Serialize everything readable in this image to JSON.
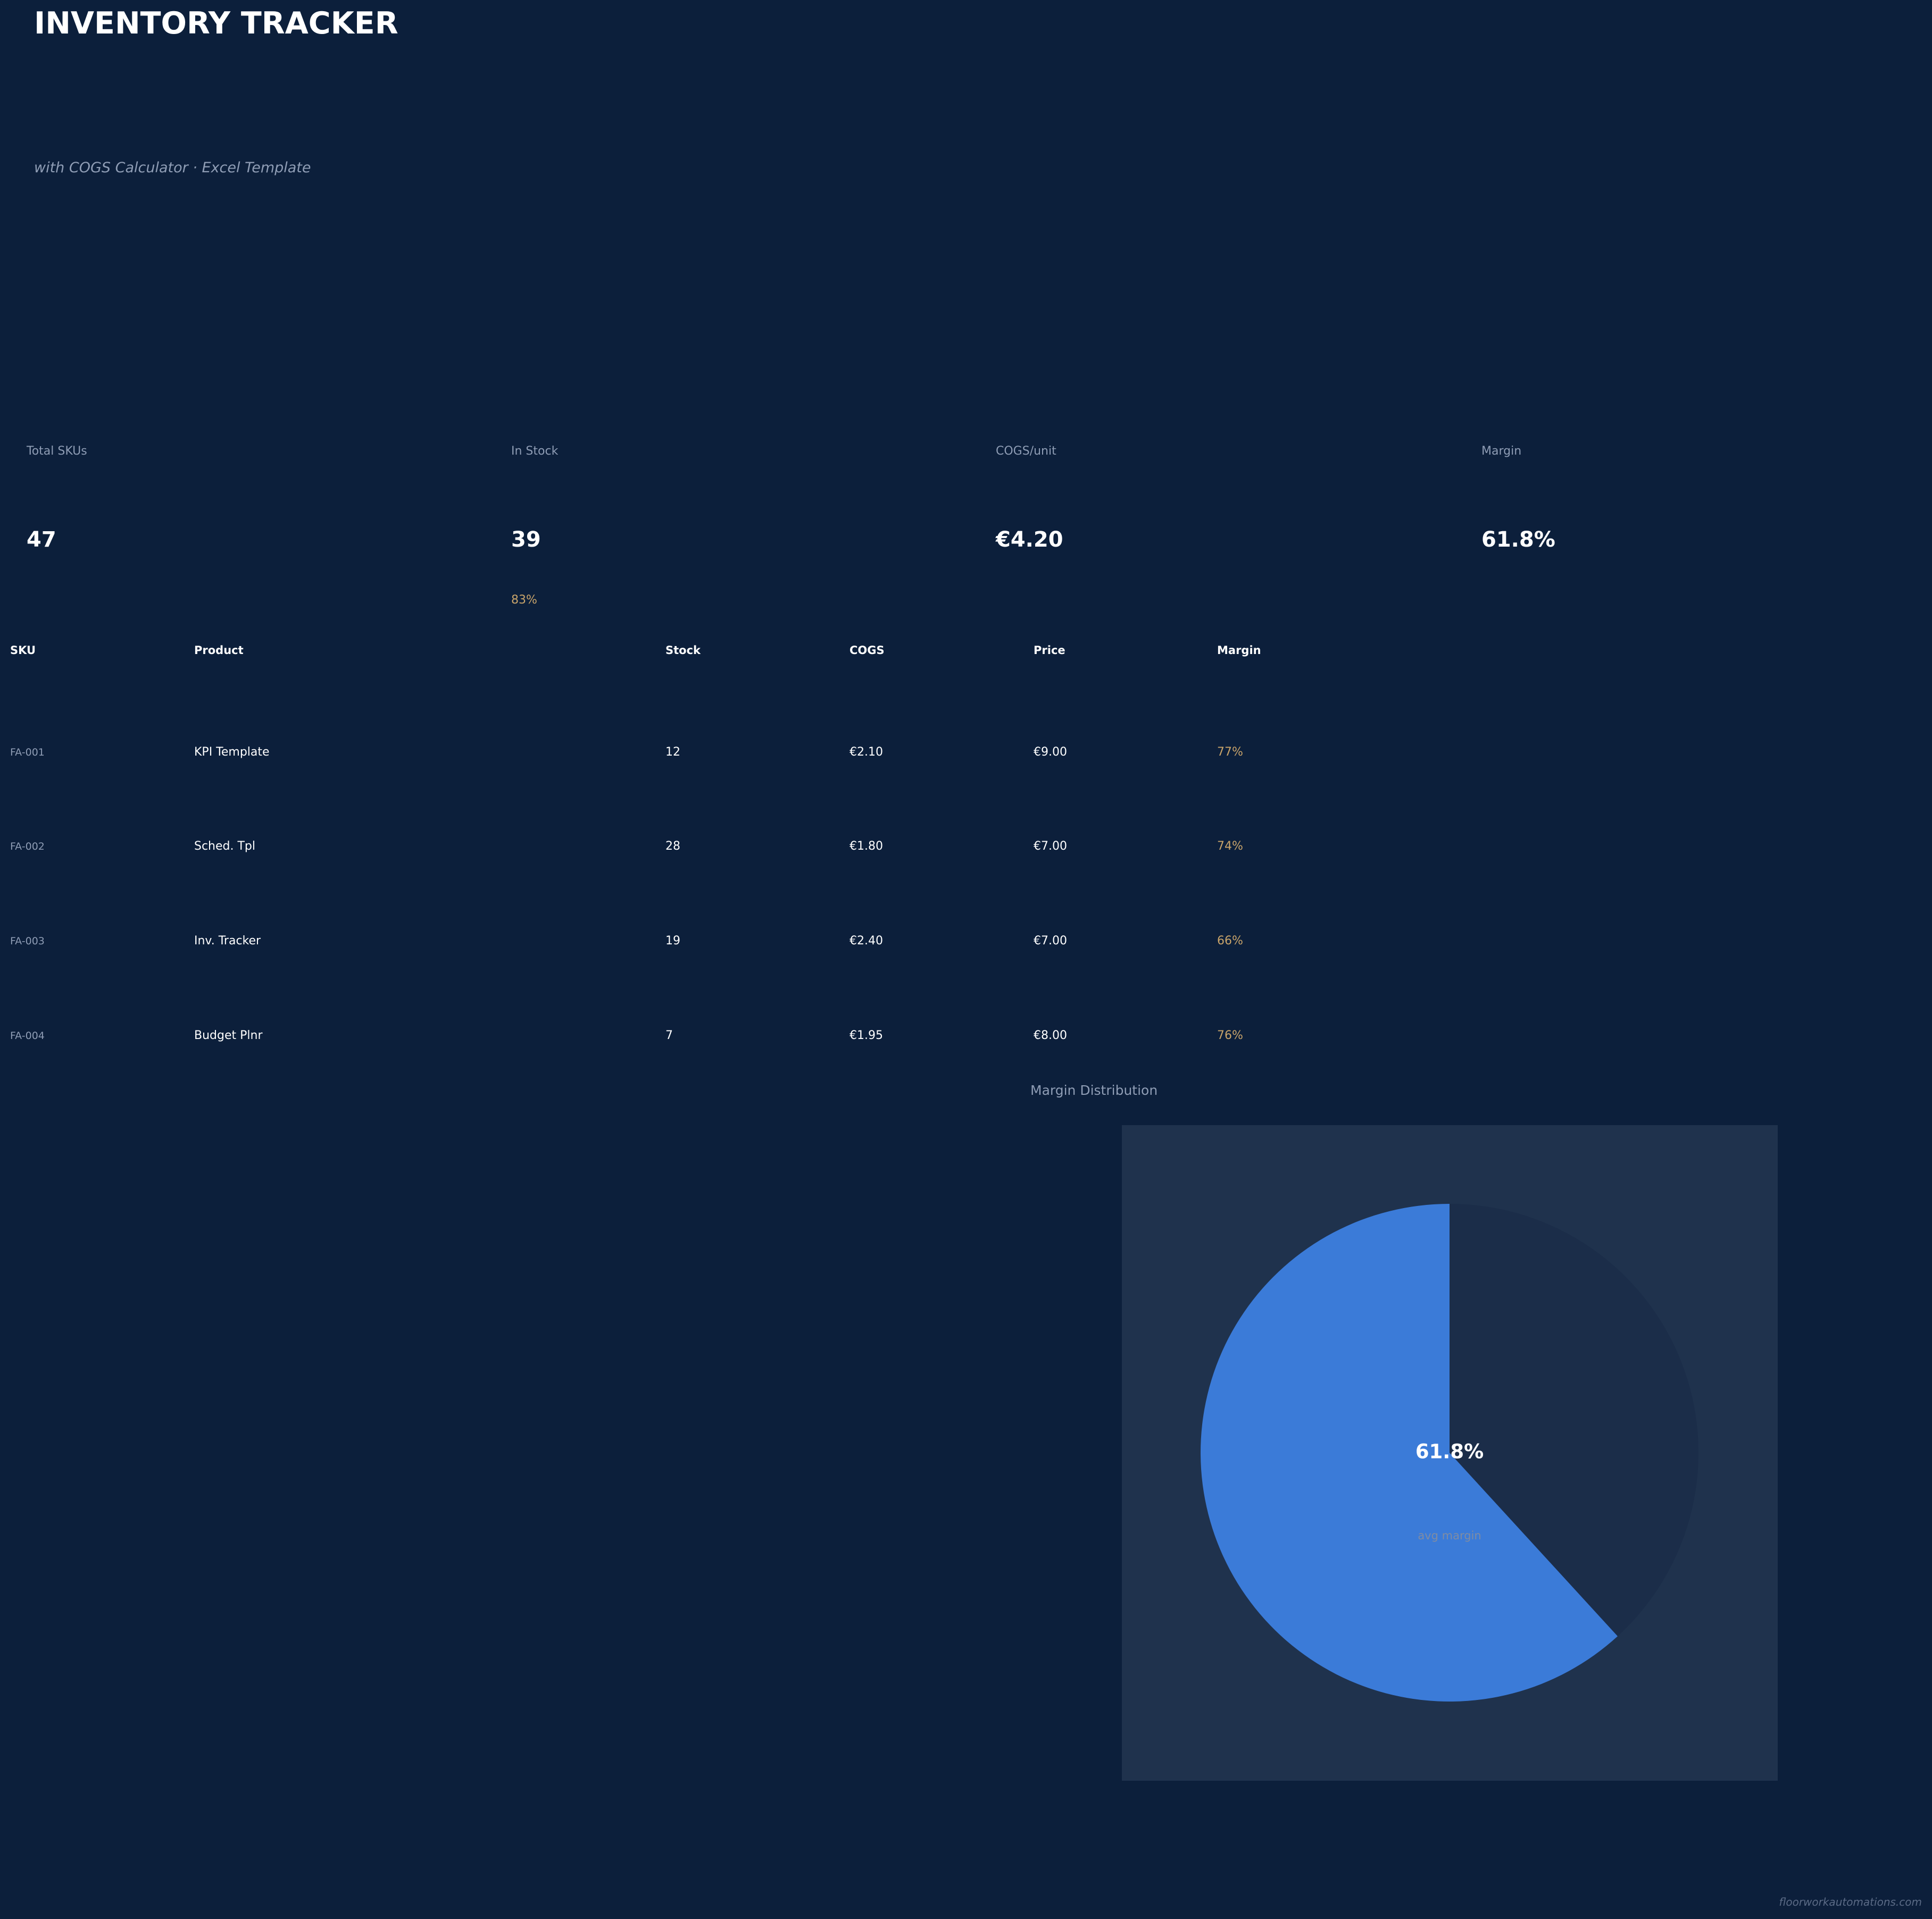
{
  "header": {
    "title": "INVENTORY TRACKER",
    "subtitle": "with COGS Calculator  ·  Excel Template"
  },
  "kpis": [
    {
      "label": "Total SKUs",
      "value": "47",
      "sub": ""
    },
    {
      "label": "In Stock",
      "value": "39",
      "sub": "83%"
    },
    {
      "label": "COGS/unit",
      "value": "€4.20",
      "sub": ""
    },
    {
      "label": "Margin",
      "value": "61.8%",
      "sub": ""
    }
  ],
  "table": {
    "headers": [
      "SKU",
      "Product",
      "Stock",
      "COGS",
      "Price",
      "Margin"
    ],
    "rows": [
      {
        "sku": "FA-001",
        "product": "KPI Template",
        "stock": "12",
        "cogs": "€2.10",
        "price": "€9.00",
        "margin": "77%"
      },
      {
        "sku": "FA-002",
        "product": "Sched. Tpl",
        "stock": "28",
        "cogs": "€1.80",
        "price": "€7.00",
        "margin": "74%"
      },
      {
        "sku": "FA-003",
        "product": "Inv. Tracker",
        "stock": "19",
        "cogs": "€2.40",
        "price": "€7.00",
        "margin": "66%"
      },
      {
        "sku": "FA-004",
        "product": "Budget Plnr",
        "stock": "7",
        "cogs": "€1.95",
        "price": "€8.00",
        "margin": "76%"
      }
    ]
  },
  "chart_data": {
    "type": "pie",
    "title": "Margin Distribution",
    "center_value": "61.8%",
    "center_label": "avg margin",
    "values": [
      61.8,
      38.2
    ],
    "colors": [
      "#3b7bd8",
      "#1b2d49"
    ]
  },
  "colors": {
    "background": "#0c1f3b",
    "panel": "#1f324d",
    "accent": "#3b7bd8",
    "muted_text": "#8f9db5",
    "highlight": "#c9a46a"
  },
  "footer": {
    "text": "floorworkautomations.com"
  }
}
